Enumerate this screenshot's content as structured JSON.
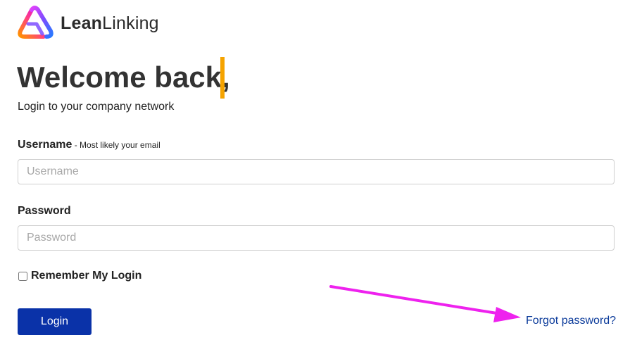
{
  "brand": {
    "name_part1": "Lean",
    "name_part2": "Linking",
    "logo_icon": "triangle-loop-logo-icon"
  },
  "heading": {
    "title": "Welcome back,",
    "subtitle": "Login to your company network"
  },
  "form": {
    "username": {
      "label": "Username",
      "hint": " - Most likely your email",
      "placeholder": "Username",
      "value": ""
    },
    "password": {
      "label": "Password",
      "placeholder": "Password",
      "value": ""
    },
    "remember": {
      "label": "Remember My Login",
      "checked": false
    },
    "login_label": "Login",
    "forgot_label": "Forgot password?"
  },
  "colors": {
    "accent_bar": "#f5a300",
    "button": "#0a32a8",
    "link": "#0a3a9a",
    "annotation_arrow": "#ee22ee"
  }
}
